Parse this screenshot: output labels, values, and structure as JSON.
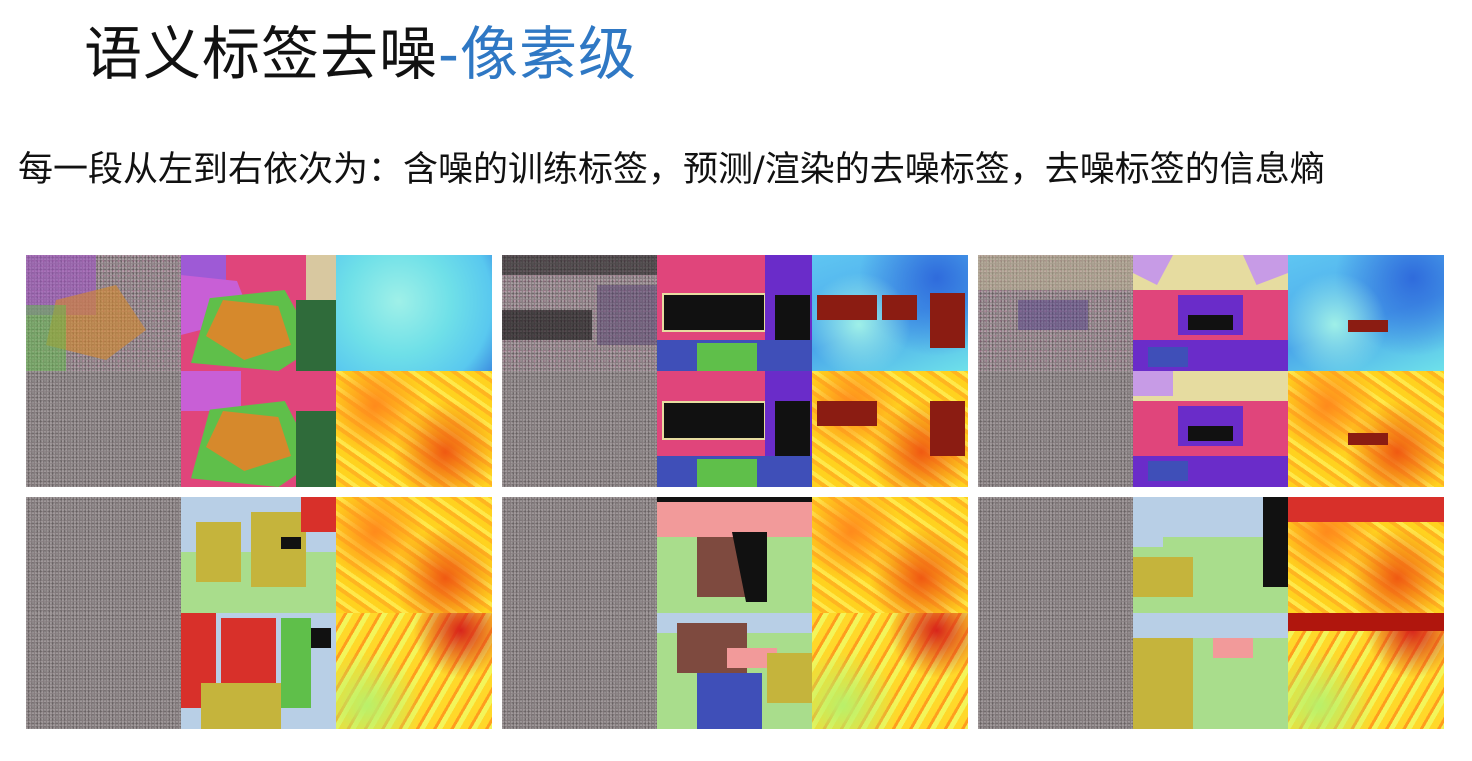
{
  "slide": {
    "title_main": "语义标签去噪",
    "title_accent": "-像素级",
    "subtitle": "每一段从左到右依次为：含噪的训练标签，预测/渲染的去噪标签，去噪标签的信息熵"
  },
  "figure": {
    "panel_count": 6,
    "column_types": [
      "noisy-training-label",
      "denoised-label",
      "entropy-map"
    ],
    "colors": {
      "magenta": "#e0457b",
      "purple": "#6a2cc9",
      "green": "#5fbf4a",
      "orange": "#d6892c",
      "black": "#111111",
      "light_blue": "#b8cfe6",
      "olive": "#c5b43c",
      "light_green": "#a9dd8c",
      "red": "#d8302a",
      "brown": "#7e4a3f",
      "indigo": "#3f4fb8",
      "pink": "#f29a9a",
      "beige": "#e6dca0",
      "lavender": "#c79be6"
    }
  }
}
